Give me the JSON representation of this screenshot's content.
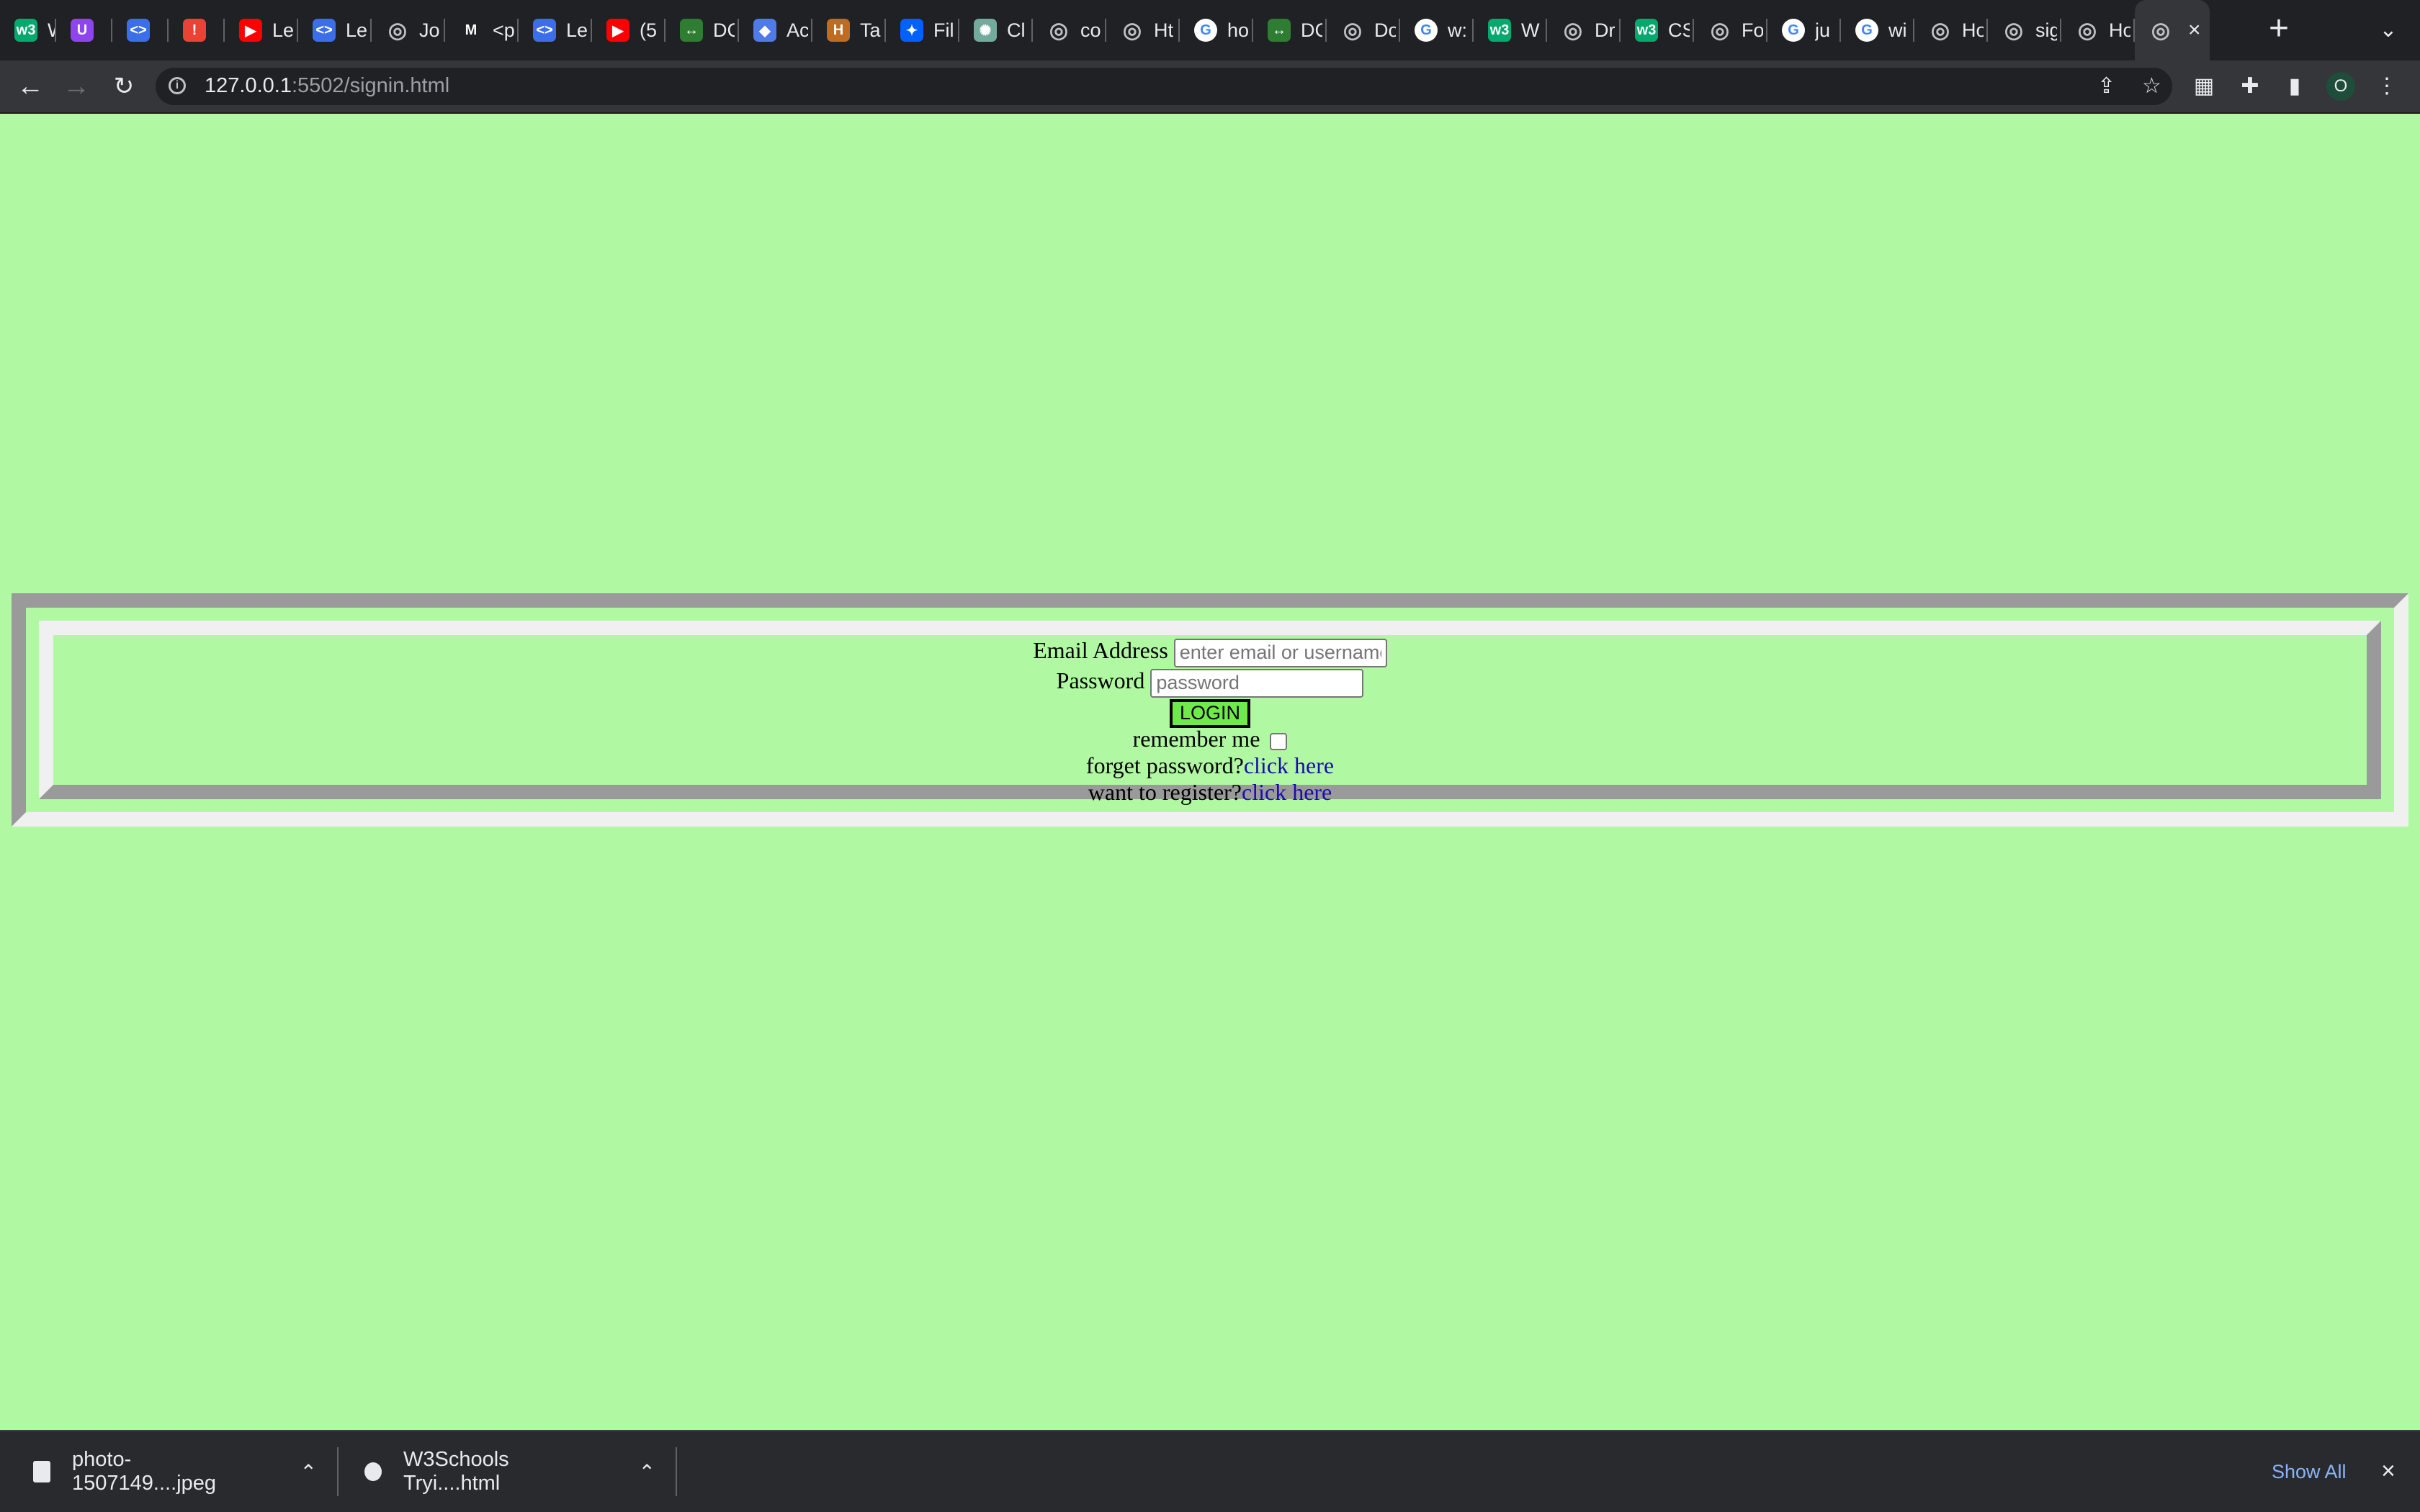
{
  "browser": {
    "tabs": [
      {
        "label": "W",
        "favicon": "w3schools-icon",
        "color": "#04aa6d",
        "glyph": "w3"
      },
      {
        "label": "",
        "favicon": "ublock-icon",
        "color": "#8e44ef",
        "glyph": "U"
      },
      {
        "label": "",
        "favicon": "code-icon",
        "color": "#3b6ee8",
        "glyph": "<>"
      },
      {
        "label": "",
        "favicon": "alert-icon",
        "color": "#ea4335",
        "glyph": "!"
      },
      {
        "label": "Le",
        "favicon": "youtube-icon",
        "color": "#ff0000",
        "glyph": "▶"
      },
      {
        "label": "Le",
        "favicon": "code-icon",
        "color": "#3b6ee8",
        "glyph": "<>"
      },
      {
        "label": "Jo",
        "favicon": "globe-icon",
        "color": "#5f6368",
        "glyph": "◎"
      },
      {
        "label": "<p",
        "favicon": "medium-icon",
        "color": "#202124",
        "glyph": "M"
      },
      {
        "label": "Le",
        "favicon": "code-icon",
        "color": "#3b6ee8",
        "glyph": "<>"
      },
      {
        "label": "(5",
        "favicon": "youtube-icon",
        "color": "#ff0000",
        "glyph": "▶"
      },
      {
        "label": "DC",
        "favicon": "arrow-icon",
        "color": "#2e7d32",
        "glyph": "↔"
      },
      {
        "label": "Ac",
        "favicon": "box-icon",
        "color": "#4f7be8",
        "glyph": "◆"
      },
      {
        "label": "Ta",
        "favicon": "hackerrank-icon",
        "color": "#c06c20",
        "glyph": "H"
      },
      {
        "label": "Fil",
        "favicon": "dropbox-icon",
        "color": "#0061fe",
        "glyph": "✦"
      },
      {
        "label": "Cl",
        "favicon": "chatgpt-icon",
        "color": "#74aa9c",
        "glyph": "✺"
      },
      {
        "label": "co",
        "favicon": "globe-icon",
        "color": "#5f6368",
        "glyph": "◎"
      },
      {
        "label": "Ht",
        "favicon": "globe-icon",
        "color": "#5f6368",
        "glyph": "◎"
      },
      {
        "label": "ho",
        "favicon": "google-icon",
        "color": "#ffffff",
        "glyph": "G"
      },
      {
        "label": "DC",
        "favicon": "arrow-icon",
        "color": "#2e7d32",
        "glyph": "↔"
      },
      {
        "label": "Do",
        "favicon": "globe-icon",
        "color": "#5f6368",
        "glyph": "◎"
      },
      {
        "label": "w:",
        "favicon": "google-icon",
        "color": "#ffffff",
        "glyph": "G"
      },
      {
        "label": "W",
        "favicon": "w3schools-icon",
        "color": "#04aa6d",
        "glyph": "w3"
      },
      {
        "label": "Dr",
        "favicon": "globe-icon",
        "color": "#5f6368",
        "glyph": "◎"
      },
      {
        "label": "CS",
        "favicon": "w3schools-icon",
        "color": "#04aa6d",
        "glyph": "w3"
      },
      {
        "label": "Fo",
        "favicon": "globe-icon",
        "color": "#5f6368",
        "glyph": "◎"
      },
      {
        "label": "ju",
        "favicon": "google-icon",
        "color": "#ffffff",
        "glyph": "G"
      },
      {
        "label": "wi",
        "favicon": "google-icon",
        "color": "#ffffff",
        "glyph": "G"
      },
      {
        "label": "Ho",
        "favicon": "globe-icon",
        "color": "#5f6368",
        "glyph": "◎"
      },
      {
        "label": "sig",
        "favicon": "globe-icon",
        "color": "#5f6368",
        "glyph": "◎"
      },
      {
        "label": "Ho",
        "favicon": "globe-icon",
        "color": "#5f6368",
        "glyph": "◎"
      }
    ],
    "active_tab": {
      "favicon": "globe-icon",
      "close": "×"
    },
    "new_tab": "+",
    "tab_list": "⌄",
    "url_host": "127.0.0.1",
    "url_rest": ":5502/signin.html",
    "profile_initial": "O"
  },
  "form": {
    "email_label": "Email Address",
    "email_placeholder": "enter email or username",
    "password_label": "Password",
    "password_placeholder": "password",
    "login_button": "LOGIN",
    "remember_label": "remember me",
    "forget_text": "forget password?",
    "forget_link": "click here",
    "register_text": "want to register?",
    "register_link": "click here"
  },
  "downloads": {
    "items": [
      {
        "name": "photo-1507149....jpeg",
        "icon": "file-icon"
      },
      {
        "name": "W3Schools Tryi....html",
        "icon": "chrome-file-icon"
      }
    ],
    "show_all": "Show All",
    "close": "×"
  },
  "colors": {
    "page_background": "#b0f9a2",
    "login_button": "#6fea4a",
    "link": "#1a0dab"
  }
}
